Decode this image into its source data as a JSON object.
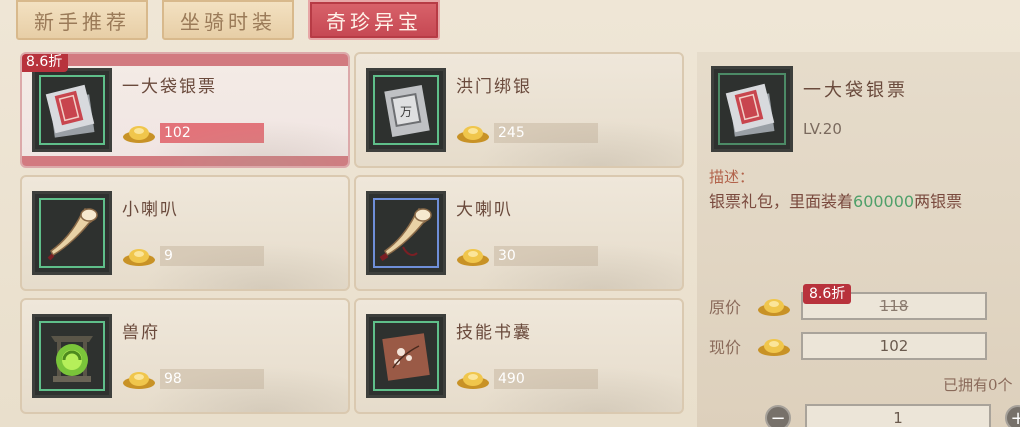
{
  "tabs": [
    {
      "label": "新手推荐",
      "active": false
    },
    {
      "label": "坐骑时装",
      "active": false
    },
    {
      "label": "奇珍异宝",
      "active": true
    }
  ],
  "items": [
    {
      "name": "一大袋银票",
      "price": "102",
      "discount": "8.6折",
      "icon": "silver-notes-bundle-icon",
      "selected": true
    },
    {
      "name": "洪门绑银",
      "price": "245",
      "icon": "bound-silver-note-icon"
    },
    {
      "name": "小喇叭",
      "price": "9",
      "icon": "small-horn-icon"
    },
    {
      "name": "大喇叭",
      "price": "30",
      "icon": "big-horn-icon"
    },
    {
      "name": "兽府",
      "price": "98",
      "icon": "beast-mansion-icon"
    },
    {
      "name": "技能书囊",
      "price": "490",
      "icon": "skill-book-pouch-icon"
    }
  ],
  "detail": {
    "name": "一大袋银票",
    "level": "LV.20",
    "desc_label": "描述：",
    "desc_before": "银票礼包，里面装着",
    "desc_amount": "600000",
    "desc_after": "两银票",
    "original_label": "原价",
    "original_price": "118",
    "discount": "8.6折",
    "current_label": "现价",
    "current_price": "102",
    "owned": "已拥有0个",
    "quantity": "1",
    "minus": "−",
    "plus": "+"
  },
  "colors": {
    "accent": "#c54752",
    "selected_bar": "#d27a80",
    "price_hot": "#e3737a",
    "highlight": "#4fa06a"
  }
}
